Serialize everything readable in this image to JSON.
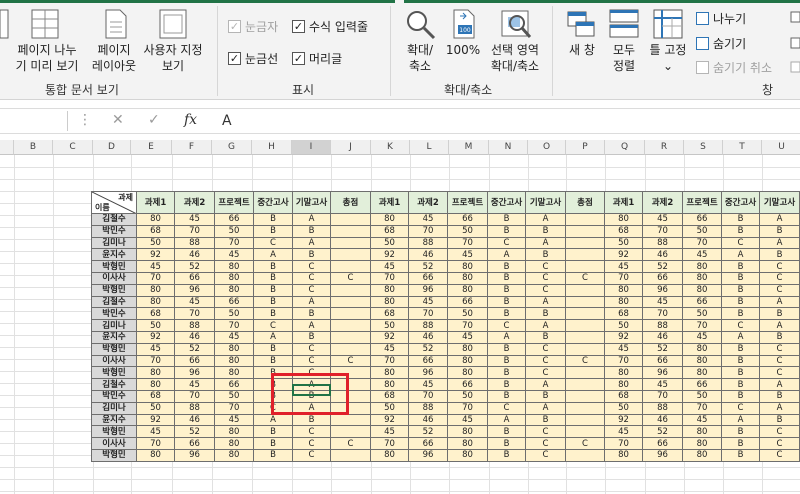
{
  "ribbon": {
    "view_buttons": [
      {
        "label1": "페이지 나누",
        "label2": "기 미리 보기"
      },
      {
        "label1": "페이지",
        "label2": "레이아웃"
      },
      {
        "label1": "사용자 지정",
        "label2": "보기"
      }
    ],
    "group_workbook_views": "통합 문서 보기",
    "show_checks": [
      {
        "label": "눈금자",
        "checked": true,
        "disabled": true
      },
      {
        "label": "수식 입력줄",
        "checked": true,
        "disabled": false
      },
      {
        "label": "눈금선",
        "checked": true,
        "disabled": false
      },
      {
        "label": "머리글",
        "checked": true,
        "disabled": false
      }
    ],
    "group_show": "표시",
    "zoom_buttons": [
      {
        "label1": "확대/",
        "label2": "축소"
      },
      {
        "label1": "100%",
        "label2": ""
      },
      {
        "label1": "선택 영역",
        "label2": "확대/축소"
      }
    ],
    "group_zoom": "확대/축소",
    "window_buttons": [
      {
        "label1": "새 창",
        "label2": ""
      },
      {
        "label1": "모두",
        "label2": "정렬"
      },
      {
        "label1": "틀 고정",
        "label2": "⌄"
      }
    ],
    "window_small": [
      {
        "label": "나누기",
        "disabled": false
      },
      {
        "label": "숨기기",
        "disabled": false
      },
      {
        "label": "숨기기 취소",
        "disabled": true
      }
    ],
    "group_window": "창",
    "colors": {
      "accent": "#217346",
      "header_fill": "#e2efda",
      "data_fill": "#fff2cc",
      "name_fill": "#d9d9d9",
      "highlight": "#e0202a"
    }
  },
  "formula_bar": {
    "cell_ref": "",
    "cancel": "✕",
    "enter": "✓",
    "fx": "fx",
    "value": "A"
  },
  "columns": [
    "B",
    "C",
    "D",
    "E",
    "F",
    "G",
    "H",
    "I",
    "J",
    "K",
    "L",
    "M",
    "N",
    "O",
    "P",
    "Q",
    "R",
    "S",
    "T",
    "U"
  ],
  "selected_column": "I",
  "table": {
    "diag_top": "과제",
    "diag_bottom": "이름",
    "headers": [
      "과제1",
      "과제2",
      "프로젝트",
      "중간고사",
      "기말고사",
      "총점",
      "과제1",
      "과제2",
      "프로젝트",
      "중간고사",
      "기말고사",
      "총점",
      "과제1",
      "과제2",
      "프로젝트",
      "중간고사",
      "기말고사"
    ],
    "rows": [
      [
        "김철수",
        "80",
        "45",
        "66",
        "B",
        "A",
        "",
        "80",
        "45",
        "66",
        "B",
        "A",
        "",
        "80",
        "45",
        "66",
        "B",
        "A"
      ],
      [
        "박민수",
        "68",
        "70",
        "50",
        "B",
        "B",
        "",
        "68",
        "70",
        "50",
        "B",
        "B",
        "",
        "68",
        "70",
        "50",
        "B",
        "B"
      ],
      [
        "김미나",
        "50",
        "88",
        "70",
        "C",
        "A",
        "",
        "50",
        "88",
        "70",
        "C",
        "A",
        "",
        "50",
        "88",
        "70",
        "C",
        "A"
      ],
      [
        "윤지수",
        "92",
        "46",
        "45",
        "A",
        "B",
        "",
        "92",
        "46",
        "45",
        "A",
        "B",
        "",
        "92",
        "46",
        "45",
        "A",
        "B"
      ],
      [
        "박형민",
        "45",
        "52",
        "80",
        "B",
        "C",
        "",
        "45",
        "52",
        "80",
        "B",
        "C",
        "",
        "45",
        "52",
        "80",
        "B",
        "C"
      ],
      [
        "이사사",
        "70",
        "66",
        "80",
        "B",
        "C",
        "C",
        "70",
        "66",
        "80",
        "B",
        "C",
        "C",
        "70",
        "66",
        "80",
        "B",
        "C"
      ],
      [
        "박형민",
        "80",
        "96",
        "80",
        "B",
        "C",
        "",
        "80",
        "96",
        "80",
        "B",
        "C",
        "",
        "80",
        "96",
        "80",
        "B",
        "C"
      ],
      [
        "김철수",
        "80",
        "45",
        "66",
        "B",
        "A",
        "",
        "80",
        "45",
        "66",
        "B",
        "A",
        "",
        "80",
        "45",
        "66",
        "B",
        "A"
      ],
      [
        "박민수",
        "68",
        "70",
        "50",
        "B",
        "B",
        "",
        "68",
        "70",
        "50",
        "B",
        "B",
        "",
        "68",
        "70",
        "50",
        "B",
        "B"
      ],
      [
        "김미나",
        "50",
        "88",
        "70",
        "C",
        "A",
        "",
        "50",
        "88",
        "70",
        "C",
        "A",
        "",
        "50",
        "88",
        "70",
        "C",
        "A"
      ],
      [
        "윤지수",
        "92",
        "46",
        "45",
        "A",
        "B",
        "",
        "92",
        "46",
        "45",
        "A",
        "B",
        "",
        "92",
        "46",
        "45",
        "A",
        "B"
      ],
      [
        "박형민",
        "45",
        "52",
        "80",
        "B",
        "C",
        "",
        "45",
        "52",
        "80",
        "B",
        "C",
        "",
        "45",
        "52",
        "80",
        "B",
        "C"
      ],
      [
        "이사사",
        "70",
        "66",
        "80",
        "B",
        "C",
        "C",
        "70",
        "66",
        "80",
        "B",
        "C",
        "C",
        "70",
        "66",
        "80",
        "B",
        "C"
      ],
      [
        "박형민",
        "80",
        "96",
        "80",
        "B",
        "C",
        "",
        "80",
        "96",
        "80",
        "B",
        "C",
        "",
        "80",
        "96",
        "80",
        "B",
        "C"
      ],
      [
        "김철수",
        "80",
        "45",
        "66",
        "B",
        "A",
        "",
        "80",
        "45",
        "66",
        "B",
        "A",
        "",
        "80",
        "45",
        "66",
        "B",
        "A"
      ],
      [
        "박민수",
        "68",
        "70",
        "50",
        "B",
        "B",
        "",
        "68",
        "70",
        "50",
        "B",
        "B",
        "",
        "68",
        "70",
        "50",
        "B",
        "B"
      ],
      [
        "김미나",
        "50",
        "88",
        "70",
        "C",
        "A",
        "",
        "50",
        "88",
        "70",
        "C",
        "A",
        "",
        "50",
        "88",
        "70",
        "C",
        "A"
      ],
      [
        "윤지수",
        "92",
        "46",
        "45",
        "A",
        "B",
        "",
        "92",
        "46",
        "45",
        "A",
        "B",
        "",
        "92",
        "46",
        "45",
        "A",
        "B"
      ],
      [
        "박형민",
        "45",
        "52",
        "80",
        "B",
        "C",
        "",
        "45",
        "52",
        "80",
        "B",
        "C",
        "",
        "45",
        "52",
        "80",
        "B",
        "C"
      ],
      [
        "이사사",
        "70",
        "66",
        "80",
        "B",
        "C",
        "C",
        "70",
        "66",
        "80",
        "B",
        "C",
        "C",
        "70",
        "66",
        "80",
        "B",
        "C"
      ],
      [
        "박형민",
        "80",
        "96",
        "80",
        "B",
        "C",
        "",
        "80",
        "96",
        "80",
        "B",
        "C",
        "",
        "80",
        "96",
        "80",
        "B",
        "C"
      ]
    ]
  }
}
